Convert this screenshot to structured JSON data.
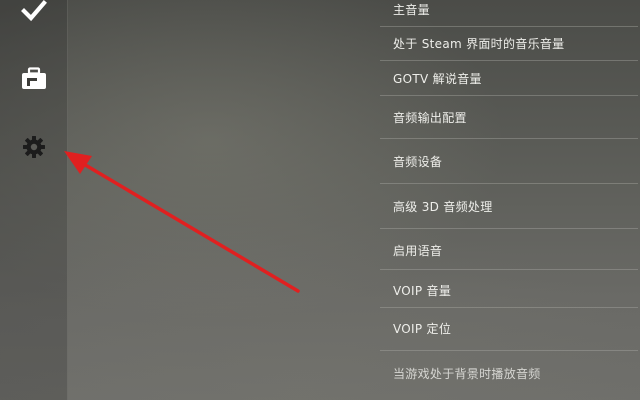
{
  "sidebar": {
    "icons": [
      {
        "name": "checkmark-icon"
      },
      {
        "name": "briefcase-icon"
      },
      {
        "name": "gear-icon"
      }
    ],
    "icon_color": "#ffffff"
  },
  "menu": {
    "items": [
      {
        "label": "主音量"
      },
      {
        "label": "处于 Steam 界面时的音乐音量"
      },
      {
        "label": "GOTV 解说音量"
      },
      {
        "label": "音频输出配置"
      },
      {
        "label": "音频设备"
      },
      {
        "label": "高级 3D 音频处理"
      },
      {
        "label": "启用语音"
      },
      {
        "label": "VOIP 音量"
      },
      {
        "label": "VOIP 定位"
      },
      {
        "label": "当游戏处于背景时播放音频"
      }
    ]
  },
  "annotation": {
    "color": "#e02020",
    "points_to": "gear-icon"
  }
}
